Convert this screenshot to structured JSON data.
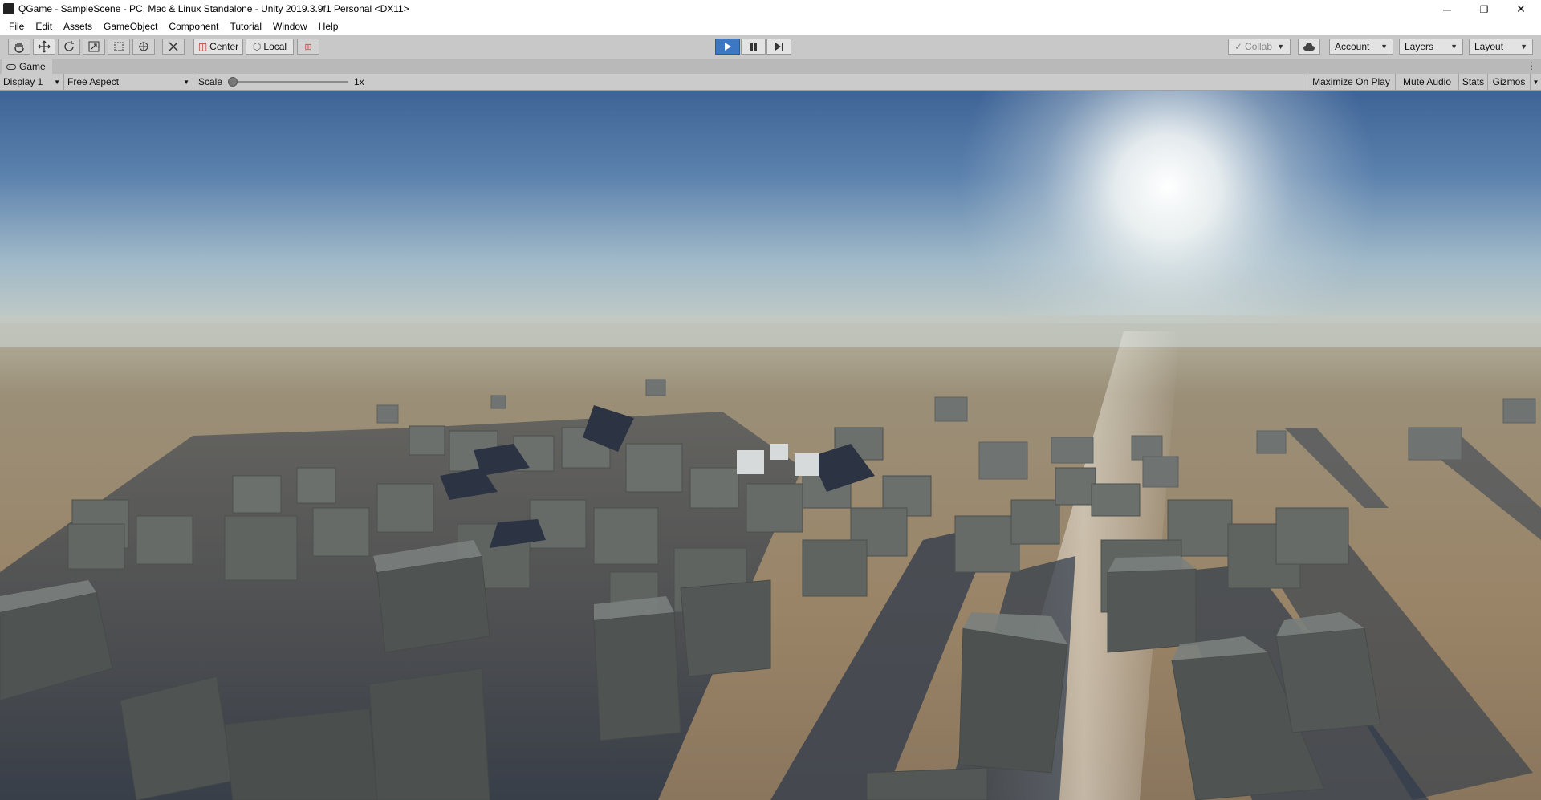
{
  "window": {
    "title": "QGame - SampleScene - PC, Mac & Linux Standalone - Unity 2019.3.9f1 Personal <DX11>",
    "minimize": "─",
    "restore": "❐",
    "close": "✕"
  },
  "menu": [
    "File",
    "Edit",
    "Assets",
    "GameObject",
    "Component",
    "Tutorial",
    "Window",
    "Help"
  ],
  "toolbar": {
    "tools": [
      "hand-icon",
      "move-icon",
      "rotate-icon",
      "scale-icon",
      "rect-icon",
      "transform-icon",
      "custom-tool-icon"
    ],
    "pivot_label": "Center",
    "space_label": "Local",
    "play_state": "playing",
    "collab_label": "Collab",
    "account_label": "Account",
    "layers_label": "Layers",
    "layout_label": "Layout"
  },
  "tab": {
    "label": "Game"
  },
  "game_bar": {
    "display": "Display 1",
    "aspect": "Free Aspect",
    "scale_label": "Scale",
    "scale_value": "1x",
    "maximize": "Maximize On Play",
    "mute": "Mute Audio",
    "stats": "Stats",
    "gizmos": "Gizmos"
  },
  "colors": {
    "play_active": "#3c77c4",
    "toolbar_bg": "#c8c8c8",
    "sky_top": "#3e6497",
    "horizon": "#c6cdc6",
    "ground": "#8a7a63"
  }
}
